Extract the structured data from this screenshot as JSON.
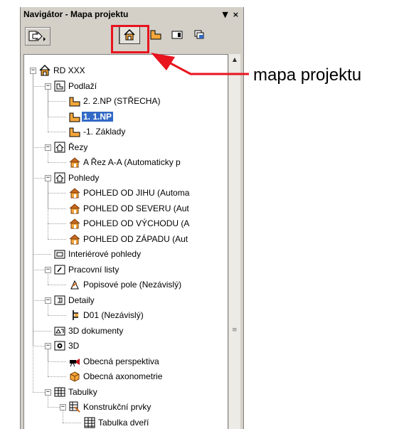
{
  "panel": {
    "title": "Navigátor - Mapa projektu",
    "title_controls": [
      "▼",
      "×"
    ]
  },
  "annotation": {
    "text": "mapa projektu",
    "color": "#e8141e"
  },
  "tree": {
    "items": [
      {
        "label": "RD XXX",
        "icon": "house-icon"
      },
      {
        "label": "Podlaží",
        "icon": "stories-icon"
      },
      {
        "label": "2. 2.NP (STŘECHA)",
        "icon": "story-icon"
      },
      {
        "label": "1. 1.NP",
        "icon": "story-icon",
        "selected": true
      },
      {
        "label": "-1. Základy",
        "icon": "story-icon"
      },
      {
        "label": "Řezy",
        "icon": "sections-icon"
      },
      {
        "label": "A Řez A-A (Automaticky p",
        "icon": "section-house-icon"
      },
      {
        "label": "Pohledy",
        "icon": "elevations-icon"
      },
      {
        "label": "POHLED OD JIHU (Automa",
        "icon": "elevation-house-icon"
      },
      {
        "label": "POHLED OD SEVERU (Aut",
        "icon": "elevation-house-icon"
      },
      {
        "label": "POHLED OD VÝCHODU (A",
        "icon": "elevation-house-icon"
      },
      {
        "label": "POHLED OD ZÁPADU (Aut",
        "icon": "elevation-house-icon"
      },
      {
        "label": "Interiérové pohledy",
        "icon": "interior-icon"
      },
      {
        "label": "Pracovní listy",
        "icon": "worksheet-icon"
      },
      {
        "label": "Popisové pole (Nezávislý)",
        "icon": "worksheet-item-icon"
      },
      {
        "label": "Detaily",
        "icon": "details-icon"
      },
      {
        "label": "D01 (Nezávislý)",
        "icon": "detail-item-icon"
      },
      {
        "label": "3D dokumenty",
        "icon": "3d-documents-icon"
      },
      {
        "label": "3D",
        "icon": "3d-icon"
      },
      {
        "label": "Obecná perspektiva",
        "icon": "camera-icon"
      },
      {
        "label": "Obecná axonometrie",
        "icon": "axonometry-icon"
      },
      {
        "label": "Tabulky",
        "icon": "schedules-icon"
      },
      {
        "label": "Konstrukční prvky",
        "icon": "elements-schedule-icon"
      },
      {
        "label": "Tabulka dveří",
        "icon": "table-icon"
      }
    ]
  }
}
